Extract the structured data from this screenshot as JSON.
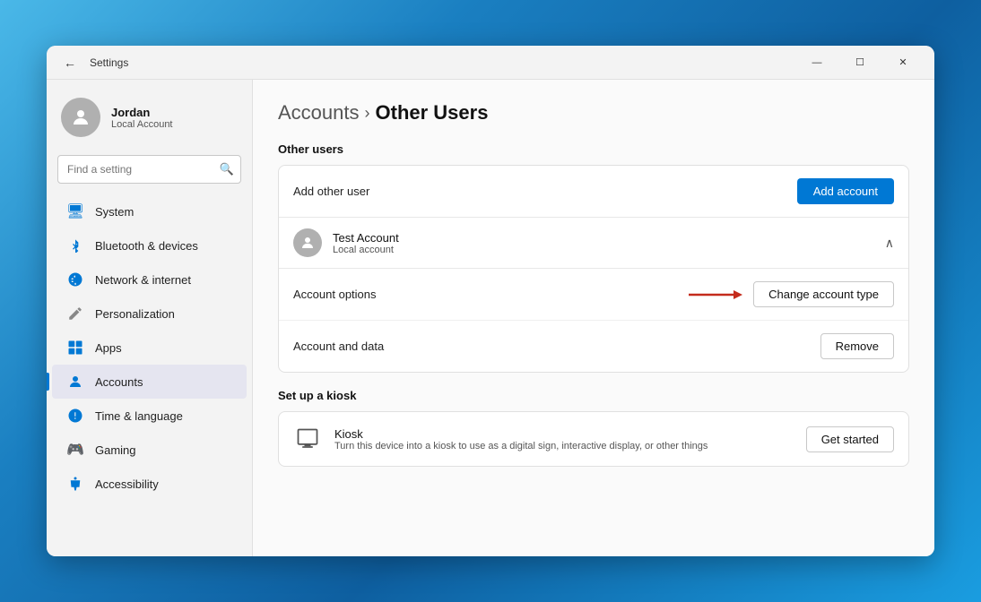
{
  "window": {
    "title": "Settings",
    "titlebar": {
      "back_label": "←",
      "title": "Settings",
      "minimize": "—",
      "maximize": "☐",
      "close": "✕"
    }
  },
  "sidebar": {
    "user": {
      "name": "Jordan",
      "type": "Local Account"
    },
    "search": {
      "placeholder": "Find a setting"
    },
    "nav": [
      {
        "id": "system",
        "label": "System",
        "icon": "🖥",
        "active": false
      },
      {
        "id": "bluetooth",
        "label": "Bluetooth & devices",
        "icon": "🔵",
        "active": false
      },
      {
        "id": "network",
        "label": "Network & internet",
        "icon": "🛡",
        "active": false
      },
      {
        "id": "personalization",
        "label": "Personalization",
        "icon": "✏",
        "active": false
      },
      {
        "id": "apps",
        "label": "Apps",
        "icon": "📦",
        "active": false
      },
      {
        "id": "accounts",
        "label": "Accounts",
        "icon": "👤",
        "active": true
      },
      {
        "id": "time",
        "label": "Time & language",
        "icon": "🕐",
        "active": false
      },
      {
        "id": "gaming",
        "label": "Gaming",
        "icon": "🎮",
        "active": false
      },
      {
        "id": "accessibility",
        "label": "Accessibility",
        "icon": "♿",
        "active": false
      }
    ]
  },
  "main": {
    "breadcrumb": {
      "parent": "Accounts",
      "separator": "›",
      "current": "Other Users"
    },
    "other_users": {
      "section_title": "Other users",
      "add_row": {
        "label": "Add other user",
        "button": "Add account"
      },
      "test_account": {
        "name": "Test Account",
        "type": "Local account",
        "options_label": "Account options",
        "change_type_btn": "Change account type",
        "data_label": "Account and data",
        "remove_btn": "Remove",
        "arrow": "→"
      }
    },
    "kiosk": {
      "section_title": "Set up a kiosk",
      "name": "Kiosk",
      "description": "Turn this device into a kiosk to use as a digital sign, interactive display, or other things",
      "button": "Get started"
    }
  }
}
